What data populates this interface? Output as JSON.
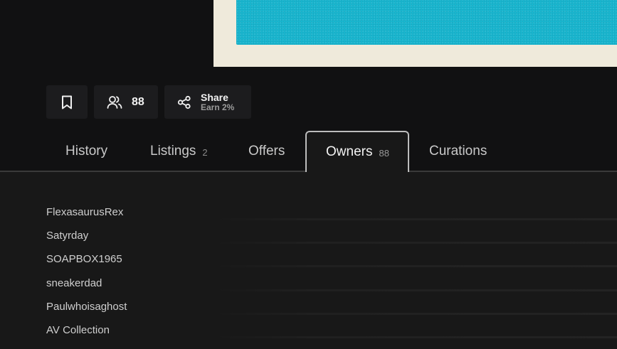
{
  "actions": {
    "owners_count": "88",
    "share_label": "Share",
    "share_sub": "Earn 2%"
  },
  "tabs": [
    {
      "label": "History",
      "count": ""
    },
    {
      "label": "Listings",
      "count": "2"
    },
    {
      "label": "Offers",
      "count": ""
    },
    {
      "label": "Owners",
      "count": "88",
      "active": true
    },
    {
      "label": "Curations",
      "count": ""
    }
  ],
  "owners": [
    "FlexasaurusRex",
    "Satyrday",
    "SOAPBOX1965",
    "sneakerdad",
    "Paulwhoisaghost",
    "AV Collection"
  ],
  "colors": {
    "background": "#111112",
    "panel": "#181818",
    "artwork_blue": "#19b6cf",
    "artwork_paper": "#efeadb",
    "active_tab_border": "#bdbdbd"
  },
  "icons": {
    "bookmark": "bookmark-icon",
    "owners": "users-icon",
    "share": "share-icon"
  }
}
